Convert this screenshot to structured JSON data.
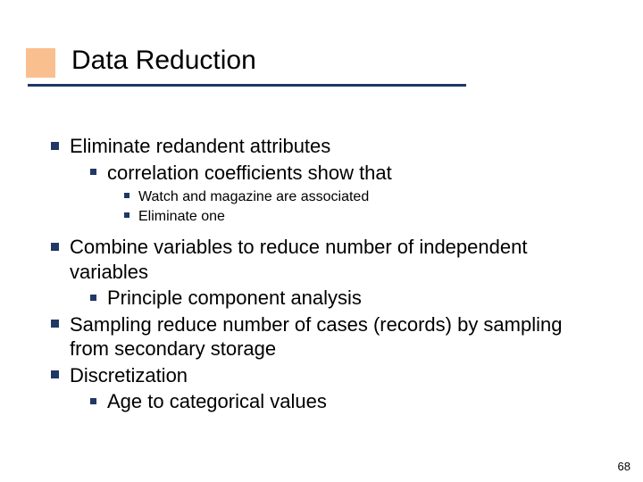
{
  "title": "Data Reduction",
  "b1": {
    "text": "Eliminate redandent attributes",
    "sub1": {
      "text": "correlation coefficients show that",
      "ssub1": "Watch and magazine are associated",
      "ssub2": "Eliminate one"
    }
  },
  "b2": {
    "text": "Combine variables to reduce number of independent variables",
    "sub1": {
      "text": "Principle component analysis"
    }
  },
  "b3": {
    "text": "Sampling reduce number of cases (records) by sampling from secondary storage"
  },
  "b4": {
    "text": "Discretization",
    "sub1": {
      "text": "Age to categorical values"
    }
  },
  "page_number": "68"
}
